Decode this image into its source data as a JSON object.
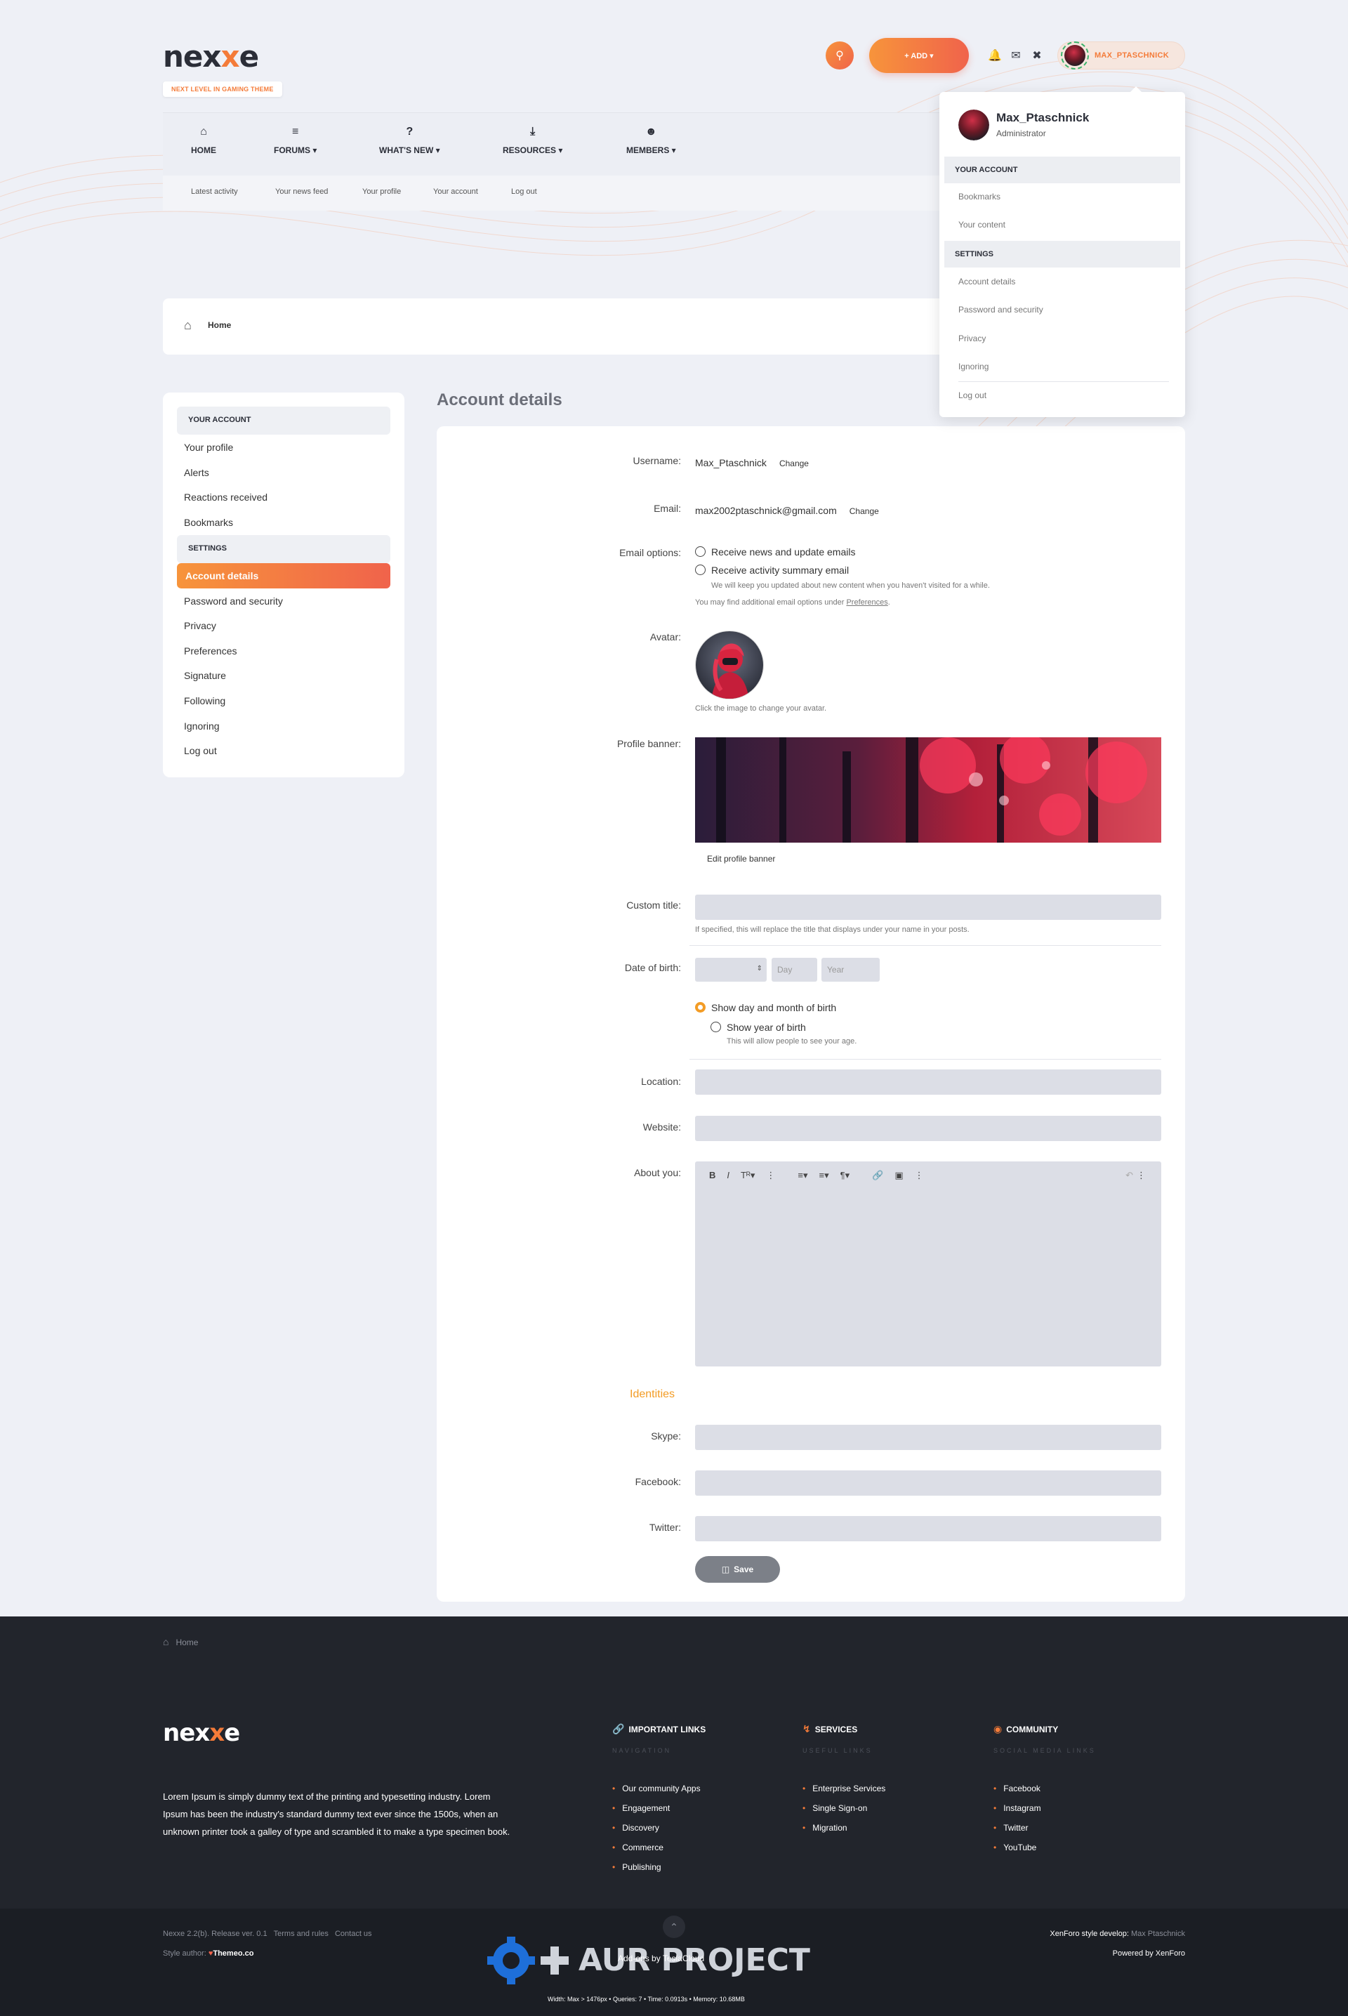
{
  "header": {
    "logo_main": "nex",
    "logo_x": "x",
    "logo_end": "e",
    "tagline": "NEXT LEVEL IN GAMING THEME",
    "add_label": "+ ADD ▾",
    "username_chip": "MAX_PTASCHNICK"
  },
  "nav": {
    "items": [
      {
        "label": "HOME",
        "icon": "home-icon"
      },
      {
        "label": "FORUMS ▾",
        "icon": "forums-icon"
      },
      {
        "label": "WHAT'S NEW ▾",
        "icon": "question-icon"
      },
      {
        "label": "RESOURCES ▾",
        "icon": "download-icon"
      },
      {
        "label": "MEMBERS ▾",
        "icon": "members-icon"
      }
    ],
    "sub": [
      "Latest activity",
      "Your news feed",
      "Your profile",
      "Your account",
      "Log out"
    ]
  },
  "breadcrumb": {
    "home": "Home"
  },
  "dropdown": {
    "name": "Max_Ptaschnick",
    "role": "Administrator",
    "section1": "YOUR ACCOUNT",
    "items1": [
      "Bookmarks",
      "Your content"
    ],
    "section2": "SETTINGS",
    "items2": [
      "Account details",
      "Password and security",
      "Privacy",
      "Ignoring"
    ],
    "logout": "Log out"
  },
  "sidebar": {
    "section1": "YOUR ACCOUNT",
    "items1": [
      "Your profile",
      "Alerts",
      "Reactions received",
      "Bookmarks"
    ],
    "section2": "SETTINGS",
    "active": "Account details",
    "items2": [
      "Password and security",
      "Privacy",
      "Preferences",
      "Signature",
      "Following",
      "Ignoring",
      "Log out"
    ]
  },
  "form": {
    "title": "Account details",
    "username_label": "Username:",
    "username": "Max_Ptaschnick",
    "change": "Change",
    "email_label": "Email:",
    "email": "max2002ptaschnick@gmail.com",
    "email_opts_label": "Email options:",
    "opt_news": "Receive news and update emails",
    "opt_summary": "Receive activity summary email",
    "summary_hint": "We will keep you updated about new content when you haven't visited for a while.",
    "prefs_hint_pre": "You may find additional email options under ",
    "prefs_link": "Preferences",
    "prefs_hint_post": ".",
    "avatar_label": "Avatar:",
    "avatar_hint": "Click the image to change your avatar.",
    "banner_label": "Profile banner:",
    "edit_banner": "Edit profile banner",
    "custom_title_label": "Custom title:",
    "custom_title_hint": "If specified, this will replace the title that displays under your name in your posts.",
    "dob_label": "Date of birth:",
    "day_ph": "Day",
    "year_ph": "Year",
    "show_day": "Show day and month of birth",
    "show_year": "Show year of birth",
    "show_year_hint": "This will allow people to see your age.",
    "location_label": "Location:",
    "website_label": "Website:",
    "about_label": "About you:",
    "identities": "Identities",
    "skype_label": "Skype:",
    "facebook_label": "Facebook:",
    "twitter_label": "Twitter:",
    "save": "Save"
  },
  "footer": {
    "crumb": "Home",
    "text": "Lorem Ipsum is simply dummy text of the printing and typesetting industry. Lorem Ipsum has been the industry's standard dummy text ever since the 1500s, when an unknown printer took a galley of type and scrambled it to make a type specimen book.",
    "col1": {
      "title": "IMPORTANT LINKS",
      "sub": "NAVIGATION",
      "links": [
        "Our community Apps",
        "Engagement",
        "Discovery",
        "Commerce",
        "Publishing"
      ]
    },
    "col2": {
      "title": "SERVICES",
      "sub": "USEFUL LINKS",
      "links": [
        "Enterprise Services",
        "Single Sign-on",
        "Migration"
      ]
    },
    "col3": {
      "title": "COMMUNITY",
      "sub": "SOCIAL MEDIA LINKS",
      "links": [
        "Facebook",
        "Instagram",
        "Twitter",
        "YouTube"
      ]
    },
    "release": "Nexxe 2.2(b). Release ver. 0.1",
    "terms": "Terms and rules",
    "contact": "Contact us",
    "style_author_label": "Style author:",
    "style_author": "Themeo.co",
    "develop_label": "XenForo style develop:",
    "develop_name": "Max Ptaschnick",
    "powered": "Powered by XenForo",
    "addons": "Add-ons by TeslaCloud",
    "stats": "Width: Max > 1476px • Queries: 7 • Time: 0.0913s • Memory: 10.68MB",
    "watermark": "AUR PROJECT"
  },
  "colors": {
    "accent": "#f47b39",
    "accent2": "#f0634b",
    "footer": "#22252c"
  }
}
